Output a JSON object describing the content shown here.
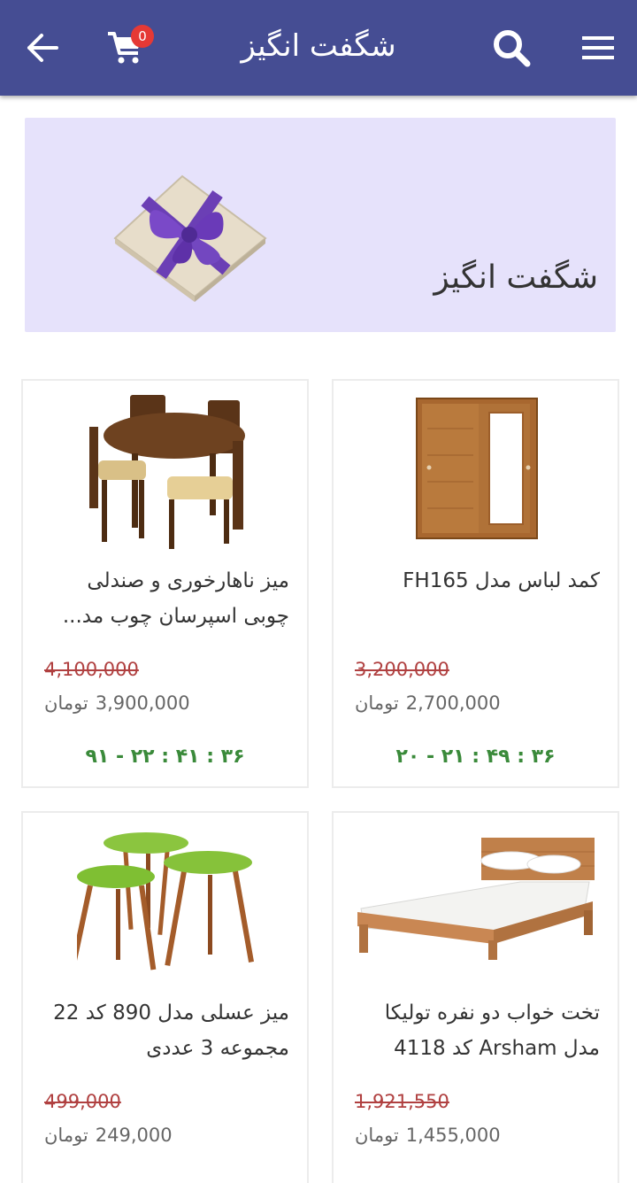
{
  "header": {
    "title": "شگفت انگیز",
    "cart_count": "0",
    "icons": [
      "arrow-back-icon",
      "cart-icon",
      "search-icon",
      "menu-icon"
    ],
    "background_color": "#454d93"
  },
  "banner": {
    "title": "شگفت انگیز",
    "background_color": "#e6e2fb"
  },
  "products": [
    {
      "name": "کمد لباس مدل FH165",
      "old_price": "3,200,000",
      "price": "2,700,000",
      "currency": "تومان",
      "timer": "۲۰ - ۲۱ : ۴۹ : ۳۶"
    },
    {
      "name": "میز ناهارخوری و صندلی چوبی اسپرسان چوب مد...",
      "old_price": "4,100,000",
      "price": "3,900,000",
      "currency": "تومان",
      "timer": "۹۱ - ۲۲ : ۴۱ : ۳۶"
    },
    {
      "name": "تخت خواب دو نفره تولیکا مدل Arsham کد 4118",
      "old_price": "1,921,550",
      "price": "1,455,000",
      "currency": "تومان"
    },
    {
      "name": "میز عسلی مدل 890 کد 22 مجموعه 3 عددی",
      "old_price": "499,000",
      "price": "249,000",
      "currency": "تومان"
    }
  ],
  "colors": {
    "old_price": "#b04040",
    "timer": "#3a8a3a"
  }
}
